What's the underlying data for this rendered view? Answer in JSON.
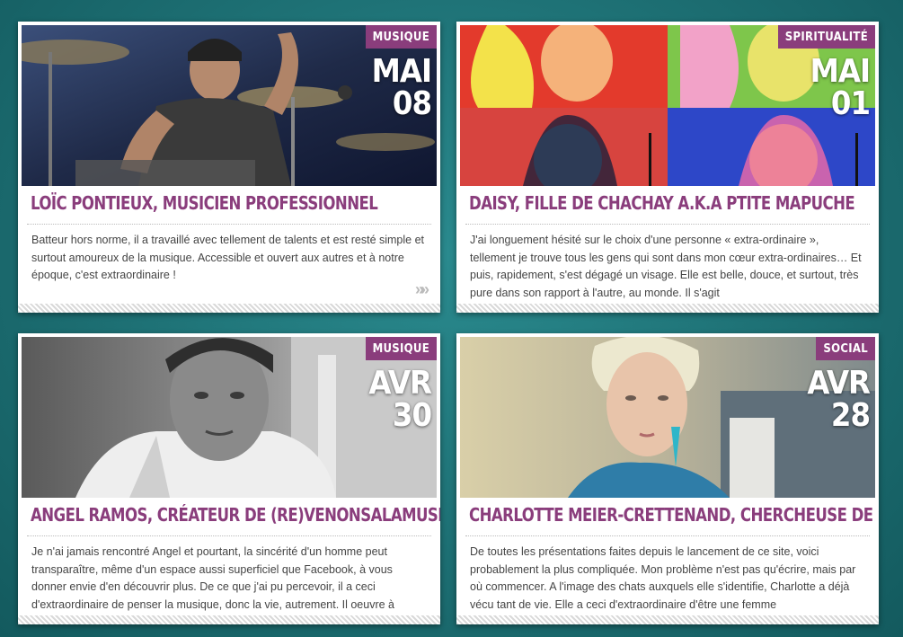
{
  "colors": {
    "accent": "#8a3d7c",
    "background": "#1d6f73"
  },
  "cards": [
    {
      "category": "MUSIQUE",
      "month": "MAI",
      "day": "08",
      "title": "LOÏC PONTIEUX, MUSICIEN PROFESSIONNEL",
      "excerpt": "Batteur hors norme, il a travaillé avec tellement de talents et est resté simple et surtout amoureux de la musique. Accessible et ouvert aux autres et à notre époque, c'est extraordinaire !",
      "more": "»»"
    },
    {
      "category": "SPIRITUALITÉ",
      "month": "MAI",
      "day": "01",
      "title": "DAISY, FILLE DE CHACHAY A.K.A PTITE MAPUCHE",
      "excerpt": "J'ai longuement hésité sur le choix d'une personne « extra-ordinaire », tellement je trouve tous les gens qui sont dans mon cœur extra-ordinaires… Et puis, rapidement, s'est dégagé un visage. Elle est belle, douce, et surtout, très pure dans son rapport à l'autre, au monde. Il s'agit"
    },
    {
      "category": "MUSIQUE",
      "month": "AVR",
      "day": "30",
      "title": "ANGEL RAMOS, CRÉATEUR DE (RE)VENONSALAMUSIQUE.COM",
      "excerpt": "Je n'ai jamais rencontré Angel et pourtant, la sincérité d'un homme peut transparaître, même d'un espace aussi superficiel que Facebook, à vous donner envie d'en découvrir plus. De ce que j'ai pu percevoir, il a ceci d'extraordinaire de penser la musique, donc la vie, autrement. Il oeuvre à"
    },
    {
      "category": "SOCIAL",
      "month": "AVR",
      "day": "28",
      "title": "CHARLOTTE MEIER-CRETTENAND, CHERCHEUSE DE SENS",
      "excerpt": "De toutes les présentations faites depuis le lancement de ce site, voici probablement la plus compliquée. Mon problème n'est pas qu'écrire, mais par où commencer. A l'image des chats auxquels elle s'identifie, Charlotte a déjà vécu tant de vie. Elle a ceci d'extraordinaire d'être une femme"
    }
  ]
}
